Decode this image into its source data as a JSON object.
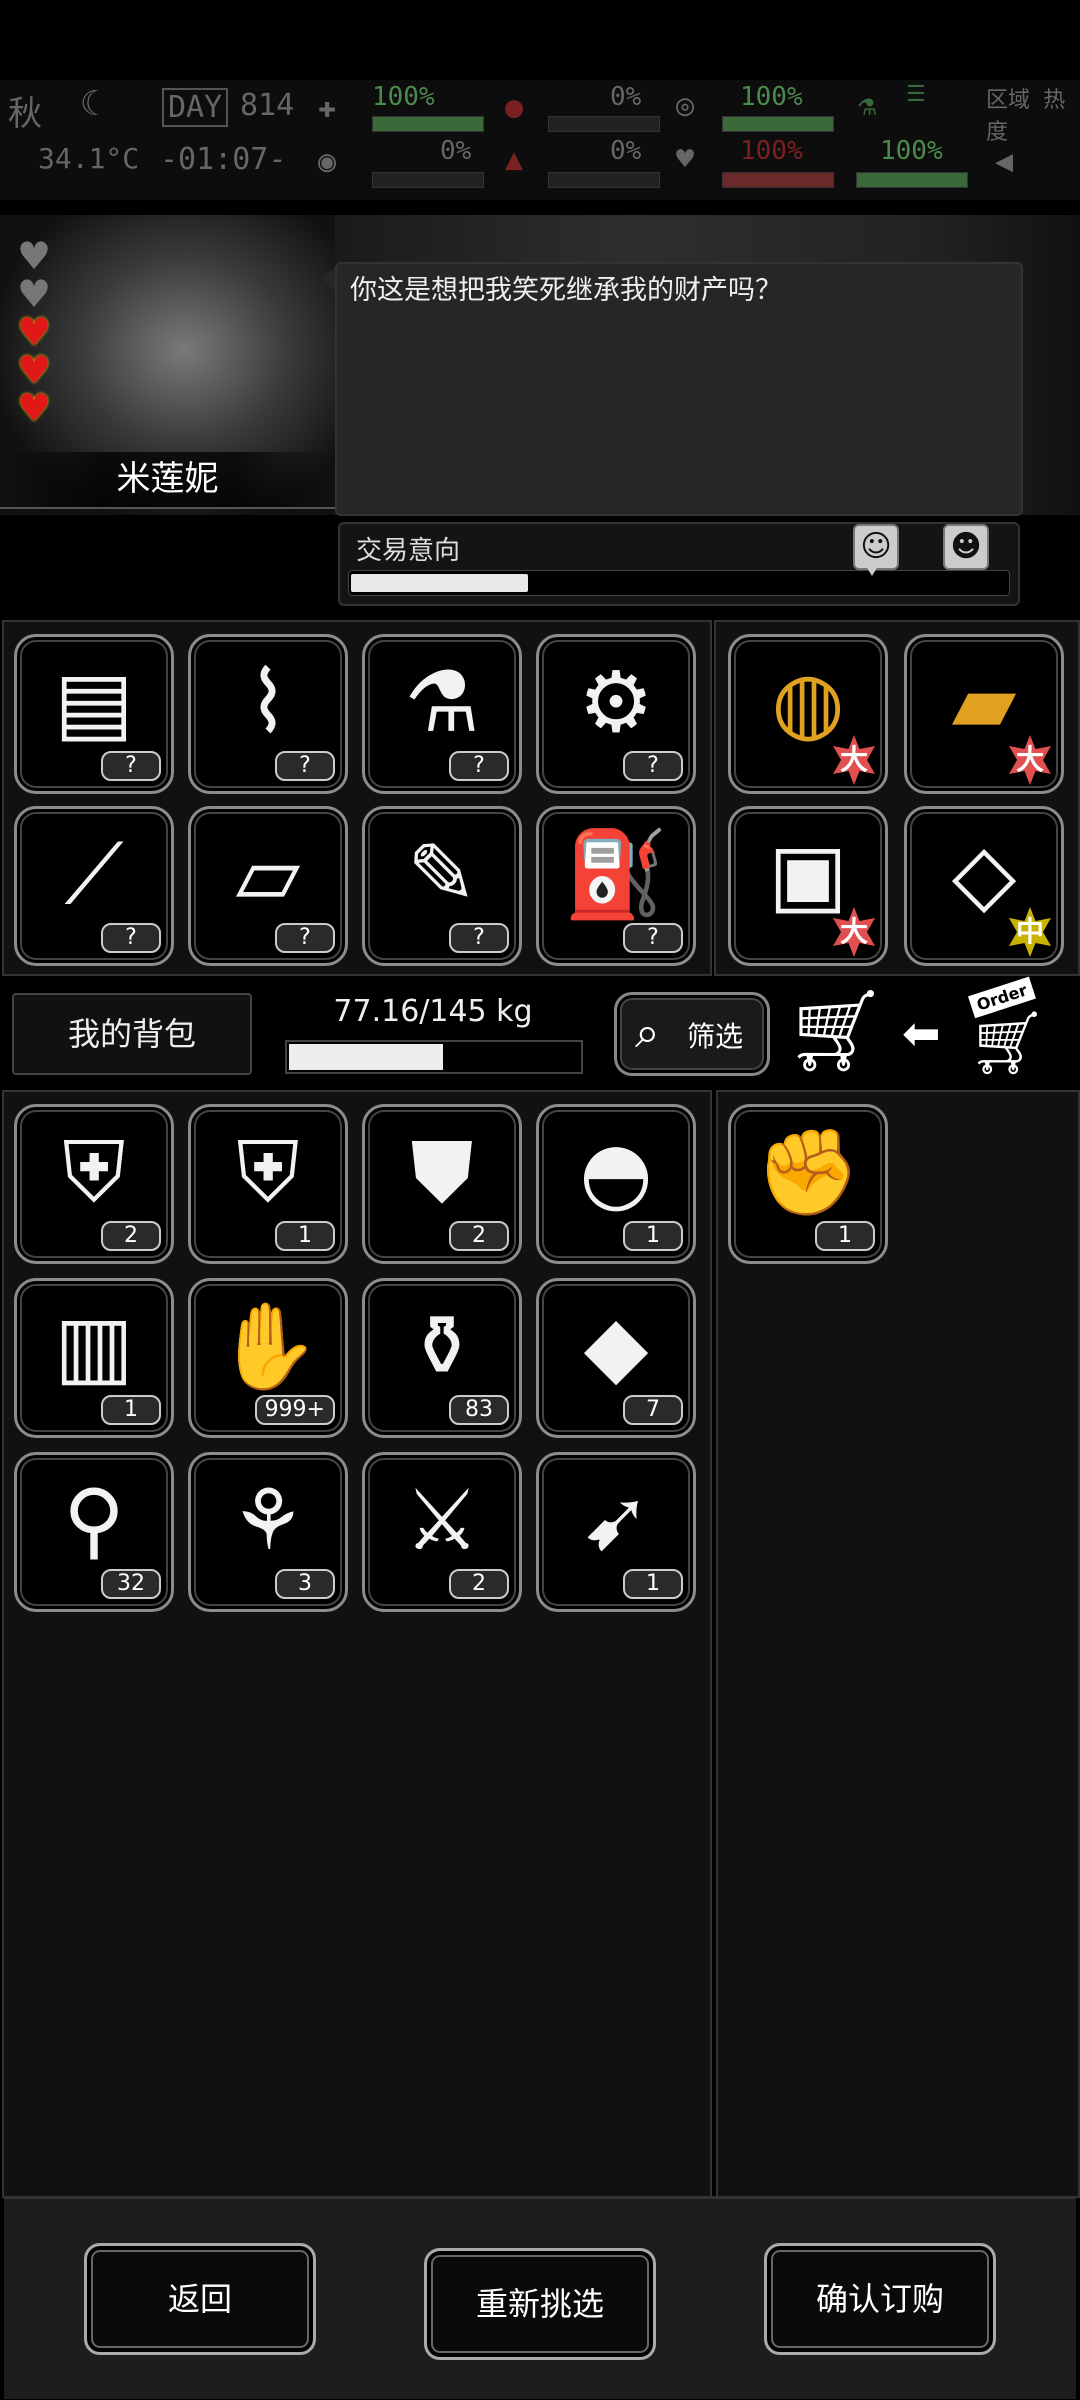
{
  "hud": {
    "season": "秋",
    "day_label": "DAY",
    "day_value": "814",
    "temperature": "34.1°C",
    "clock": "-01:07-",
    "stats": [
      {
        "value": "100%",
        "icon": "medkit-icon"
      },
      {
        "value": "0%",
        "icon": "blood-icon"
      },
      {
        "value": "100%",
        "icon": "stomach-icon"
      },
      {
        "value": "0%",
        "icon": "eye-icon"
      },
      {
        "value": "0%",
        "icon": "drop-icon"
      },
      {
        "value": "100%",
        "icon": "heart-icon"
      },
      {
        "value": "100%",
        "icon": "flask-icon"
      }
    ],
    "zone_heat_label": "区域\n热度"
  },
  "npc": {
    "name": "米莲妮",
    "hearts_filled": 3,
    "hearts_total": 5,
    "dialogue": "你这是想把我笑死继承我的财产吗？"
  },
  "trade_intent": {
    "label": "交易意向",
    "level": 0.27
  },
  "shop_items": [
    {
      "name": "cloth-icon",
      "count": "?"
    },
    {
      "name": "pipes-icon",
      "count": "?"
    },
    {
      "name": "glue-tube-icon",
      "count": "?"
    },
    {
      "name": "scrap-parts-icon",
      "count": "?"
    },
    {
      "name": "nails-icon",
      "count": "?"
    },
    {
      "name": "paper-icon",
      "count": "?"
    },
    {
      "name": "brush-icon",
      "count": "?"
    },
    {
      "name": "spray-bottle-icon",
      "count": "?"
    }
  ],
  "offer_items": [
    {
      "name": "coin-stack-icon",
      "size": "大",
      "color": "#e0a020"
    },
    {
      "name": "gold-bars-icon",
      "size": "大",
      "color": "#e0a020"
    },
    {
      "name": "bag-icon",
      "size": "大",
      "color": "#f2f2f2"
    },
    {
      "name": "scrap-sheet-icon",
      "size": "中",
      "color": "#f2f2f2"
    }
  ],
  "toolbar": {
    "bag_label": "我的背包",
    "weight": "77.16/145 kg",
    "weight_fraction": 0.532,
    "filter_label": "筛选",
    "order_label": "Order"
  },
  "bag_items": [
    {
      "name": "mech-armor-icon",
      "count": "2"
    },
    {
      "name": "power-armor-icon",
      "count": "1"
    },
    {
      "name": "body-armor-icon",
      "count": "2"
    },
    {
      "name": "helmet-icon",
      "count": "1"
    },
    {
      "name": "vest-icon",
      "count": "1"
    },
    {
      "name": "zombie-card-icon",
      "count": "999+"
    },
    {
      "name": "grenades-icon",
      "count": "83"
    },
    {
      "name": "gold-crystal-icon",
      "count": "7"
    },
    {
      "name": "test-tube-icon",
      "count": "32"
    },
    {
      "name": "boots-icon",
      "count": "3"
    },
    {
      "name": "minigun-icon",
      "count": "2"
    },
    {
      "name": "rocket-launcher-icon",
      "count": "1"
    }
  ],
  "selected_items": [
    {
      "name": "zombie-arm-icon",
      "count": "1"
    }
  ],
  "buttons": {
    "back": "返回",
    "reselect": "重新挑选",
    "confirm": "确认订购"
  }
}
